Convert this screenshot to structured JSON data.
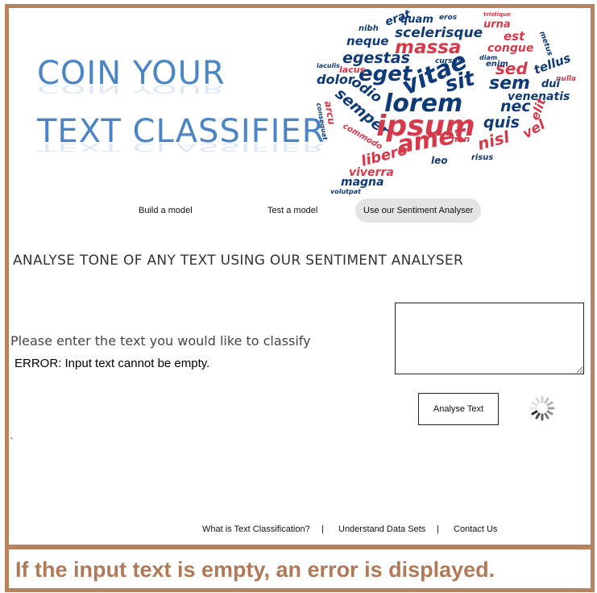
{
  "logo": {
    "line1": "COIN YOUR",
    "line2": "TEXT CLASSIFIER"
  },
  "word_cloud": {
    "words": [
      "quam",
      "erat",
      "eros",
      "tristique",
      "urna",
      "nibh",
      "scelerisque",
      "est",
      "metus",
      "neque",
      "massa",
      "congue",
      "egestas",
      "cursus",
      "diam",
      "iaculis",
      "eget",
      "vitae",
      "sed",
      "tellus",
      "dolor",
      "enim",
      "nulla",
      "odio",
      "sit",
      "sem",
      "venenatis",
      "arcu",
      "lorem",
      "dui",
      "consequat",
      "semper",
      "nec",
      "ipsum",
      "quis",
      "elit",
      "lacus",
      "commodo",
      "amet",
      "nisl",
      "vel",
      "libero",
      "leo",
      "risus",
      "non",
      "viverra",
      "magna",
      "volutpat"
    ]
  },
  "nav": {
    "build": "Build a  model",
    "test": "Test a model",
    "sentiment": "Use our Sentiment Analyser"
  },
  "main": {
    "heading": "ANALYSE TONE OF ANY TEXT USING OUR SENTIMENT ANALYSER",
    "prompt": "Please enter the text you would like to classify",
    "error": "ERROR: Input text cannot be empty.",
    "textarea_value": "",
    "button_label": "Analyse Text",
    "tick": "`"
  },
  "footer": {
    "link1": "What is Text Classification?",
    "sep1": "|",
    "link2": "Understand Data Sets",
    "sep2": "|",
    "link3": "Contact Us"
  },
  "caption": "If the input text is empty, an error is displayed.",
  "colors": {
    "frame": "#b8835f",
    "caption_text": "#b07a58",
    "logo_blue": "#4a86c5",
    "cloud_navy": "#0f3a78",
    "cloud_red": "#d63a4a",
    "nav_active_bg": "#e4e4e4"
  }
}
